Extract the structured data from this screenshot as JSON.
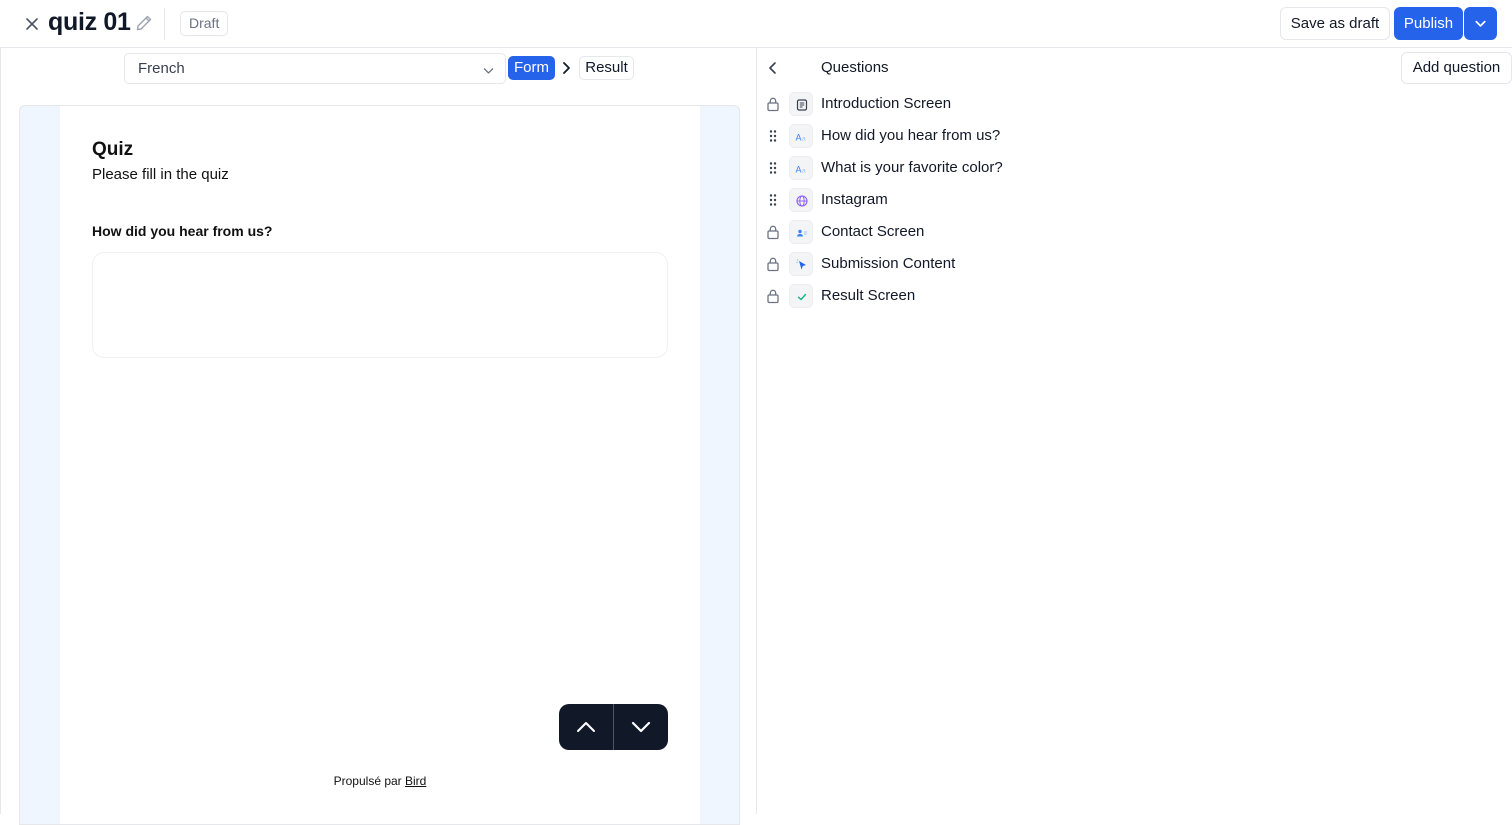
{
  "header": {
    "title": "quiz 01",
    "status_badge": "Draft",
    "save_draft_label": "Save as draft",
    "publish_label": "Publish"
  },
  "editor": {
    "language": "French",
    "steps": [
      "Form",
      "Result"
    ],
    "active_step": "Form"
  },
  "preview": {
    "quiz_title": "Quiz",
    "quiz_description": "Please fill in the quiz",
    "question_label": "How did you hear from us?",
    "powered_prefix": "Propulsé par",
    "powered_link": "Bird",
    "answer_value": ""
  },
  "questions_panel": {
    "heading": "Questions",
    "add_button_label": "Add question",
    "items": [
      {
        "label": "Introduction Screen",
        "icon": "document-icon",
        "handle": "lock-icon"
      },
      {
        "label": "How did you hear from us?",
        "icon": "text-aa-icon",
        "handle": "drag-handle-icon"
      },
      {
        "label": "What is your favorite color?",
        "icon": "text-aa-icon",
        "handle": "drag-handle-icon"
      },
      {
        "label": "Instagram",
        "icon": "globe-icon",
        "handle": "drag-handle-icon"
      },
      {
        "label": "Contact Screen",
        "icon": "contact-icon",
        "handle": "lock-icon"
      },
      {
        "label": "Submission Content",
        "icon": "cursor-icon",
        "handle": "lock-icon"
      },
      {
        "label": "Result Screen",
        "icon": "check-icon",
        "handle": "lock-icon"
      }
    ]
  },
  "colors": {
    "accent": "#2563eb",
    "nav_button_bg": "#111827",
    "preview_bg": "#eff6ff"
  }
}
